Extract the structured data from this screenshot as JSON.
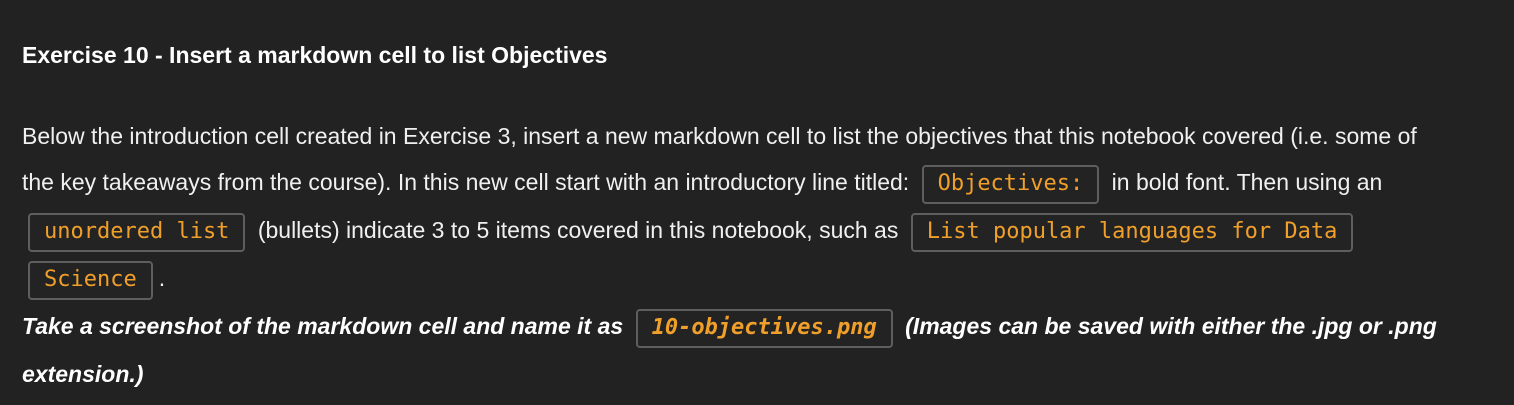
{
  "exercise": {
    "title": "Exercise 10 - Insert a markdown cell to list Objectives",
    "text_1": "Below the introduction cell created in Exercise 3, insert a new markdown cell to list the objectives that this notebook covered (i.e. some of the key takeaways from the course). In this new cell start with an introductory line titled:",
    "code_objectives": "Objectives:",
    "text_2": "in bold font. Then using an",
    "code_unordered": "unordered list",
    "text_3": "(bullets) indicate 3 to 5 items covered in this notebook, such as",
    "code_list": "List popular languages for Data Science",
    "text_4": ".",
    "note_1": "Take a screenshot of the markdown cell and name it as",
    "code_filename": "10-objectives.png",
    "note_2": "(Images can be saved with either the .jpg or .png extension.)"
  }
}
